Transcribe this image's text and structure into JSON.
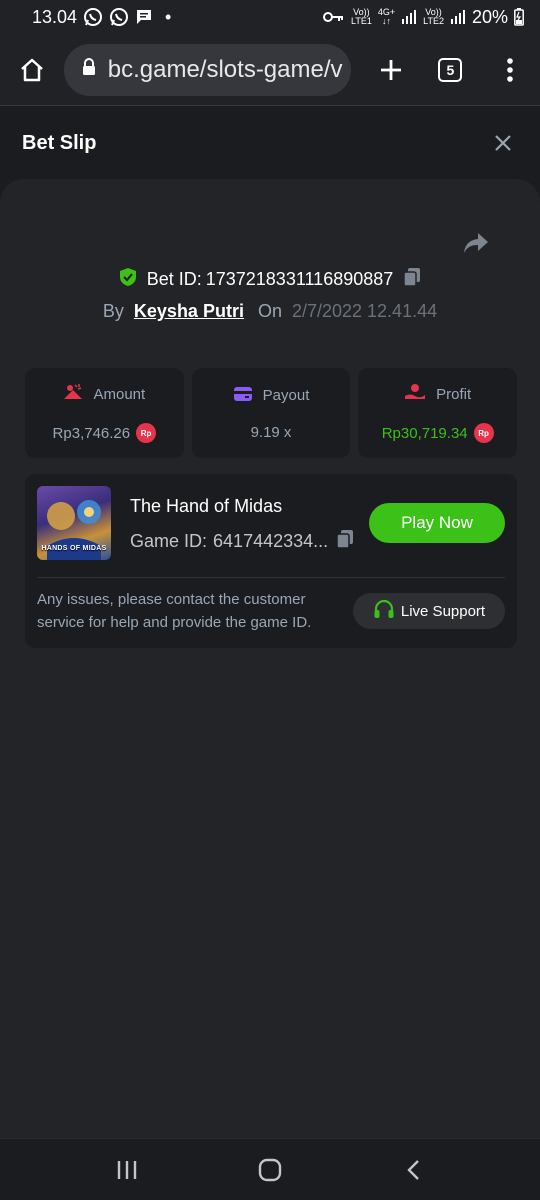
{
  "status_bar": {
    "time": "13.04",
    "dot": "•",
    "net1_top": "Vo))",
    "net1_bottom": "LTE1",
    "net_4g": "4G+",
    "net2_top": "Vo))",
    "net2_bottom": "LTE2",
    "battery": "20%"
  },
  "browser": {
    "url": "bc.game/slots-game/v",
    "tab_count": "5"
  },
  "bet_slip": {
    "title": "Bet Slip",
    "bet_id_label": "Bet ID:",
    "bet_id": "1737218331116890887",
    "by_label": "By",
    "user": "Keysha Putri",
    "on_label": "On",
    "date": "2/7/2022 12.41.44",
    "currency_badge": "Rp",
    "stats": {
      "amount_label": "Amount",
      "amount_value": "Rp3,746.26",
      "payout_label": "Payout",
      "payout_value": "9.19 x",
      "profit_label": "Profit",
      "profit_value": "Rp30,719.34"
    },
    "game": {
      "name": "The Hand of Midas",
      "id_label": "Game ID:",
      "id_value": "6417442334...",
      "thumb_label": "HANDS OF MIDAS",
      "play_label": "Play Now",
      "help_text": "Any issues, please contact the customer service for help and provide the game ID.",
      "support_label": "Live Support"
    }
  },
  "colors": {
    "accent_green": "#3bc117",
    "badge_red": "#e6354a",
    "background": "#1b1c20",
    "card": "#232428"
  }
}
